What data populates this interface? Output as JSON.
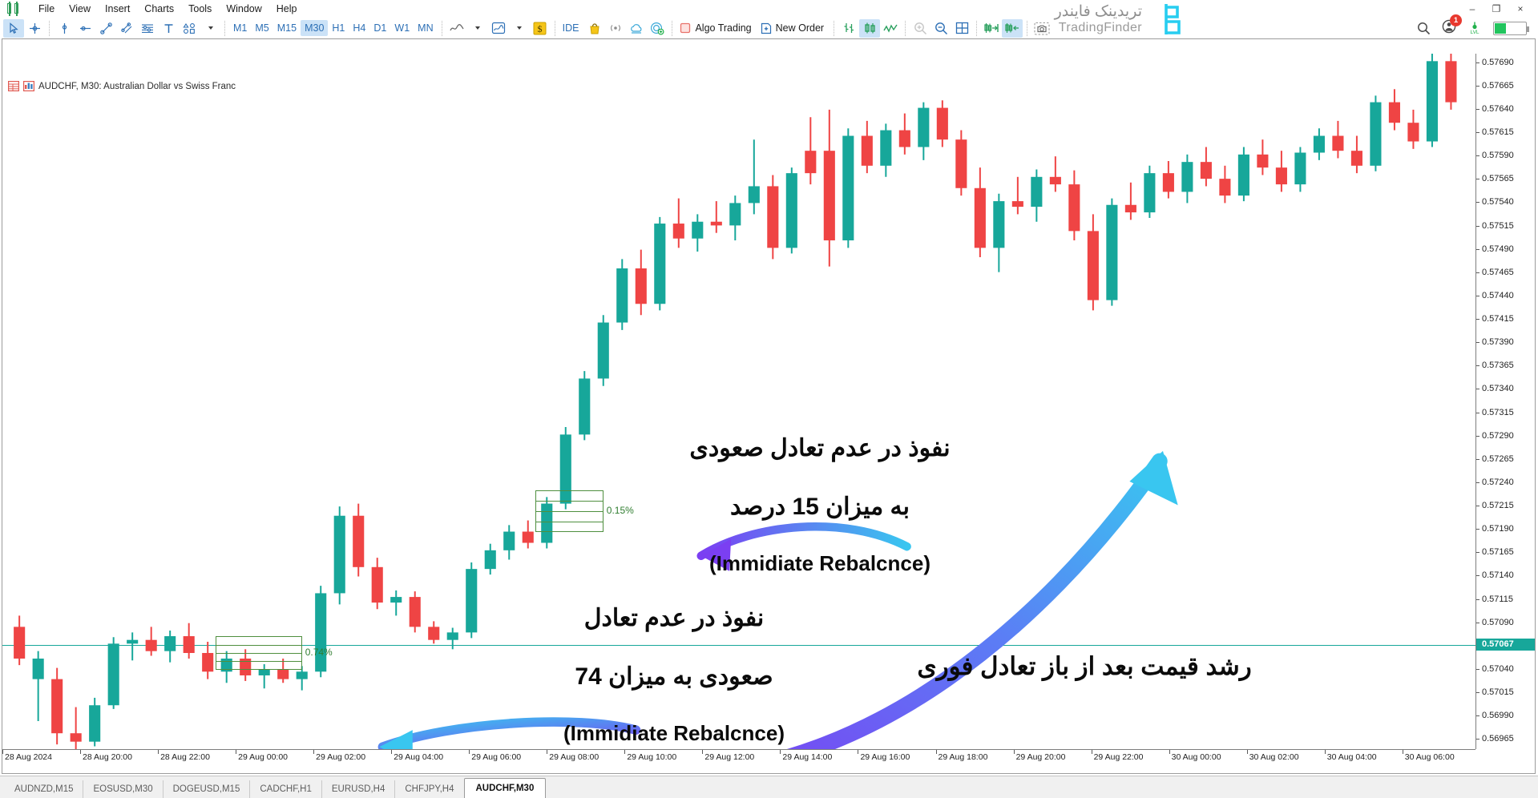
{
  "window": {
    "minimize": "–",
    "maximize": "❐",
    "close": "×"
  },
  "brand": {
    "fa": "تریدینک فایندر",
    "en": "TradingFinder",
    "mark_icon": "tradingfinder-logo-icon"
  },
  "topright": {
    "search_icon": "search-icon",
    "account_icon": "account-icon",
    "notification_count": "1",
    "level_icon": "level-meter-icon",
    "battery_icon": "battery-icon"
  },
  "menu": {
    "app_icon": "metatrader-logo-icon",
    "items": [
      {
        "label": "File"
      },
      {
        "label": "View"
      },
      {
        "label": "Insert"
      },
      {
        "label": "Charts"
      },
      {
        "label": "Tools"
      },
      {
        "label": "Window"
      },
      {
        "label": "Help"
      }
    ]
  },
  "toolbar": {
    "tools": [
      {
        "name": "cursor-tool",
        "icon": "arrow-cursor-icon",
        "active": true
      },
      {
        "name": "crosshair-tool",
        "icon": "crosshair-icon",
        "active": false
      },
      {
        "name": "vertical-line-tool",
        "icon": "vertical-line-icon",
        "active": false
      },
      {
        "name": "horizontal-line-tool",
        "icon": "horizontal-line-icon",
        "active": false
      },
      {
        "name": "trendline-tool",
        "icon": "trendline-icon",
        "active": false
      },
      {
        "name": "channel-tool",
        "icon": "equidistant-channel-icon",
        "active": false
      },
      {
        "name": "fibonacci-tool",
        "icon": "fibonacci-retracement-icon",
        "active": false
      },
      {
        "name": "text-tool",
        "icon": "text-label-icon",
        "active": false
      },
      {
        "name": "shapes-tool",
        "icon": "shapes-icon",
        "active": false
      }
    ],
    "timeframes": [
      {
        "label": "M1",
        "active": false
      },
      {
        "label": "M5",
        "active": false
      },
      {
        "label": "M15",
        "active": false
      },
      {
        "label": "M30",
        "active": true
      },
      {
        "label": "H1",
        "active": false
      },
      {
        "label": "H4",
        "active": false
      },
      {
        "label": "D1",
        "active": false
      },
      {
        "label": "W1",
        "active": false
      },
      {
        "label": "MN",
        "active": false
      }
    ],
    "indicators_icon": "indicator-line-icon",
    "templates_icon": "template-chart-icon",
    "autotrading_dollar_icon": "dollar-yellow-icon",
    "ide_label": "IDE",
    "market_icon": "market-bag-icon",
    "signals_icon": "signals-broadcast-icon",
    "vps_icon": "vps-cloud-icon",
    "copy_icon": "copy-trading-icon",
    "algo_trading_label": "Algo Trading",
    "algo_trading_icon": "algo-trading-stop-icon",
    "new_order_label": "New Order",
    "new_order_icon": "new-order-plus-icon",
    "bar_chart_icon": "bar-chart-icon",
    "candlestick_icon": "candlestick-chart-icon",
    "line_chart_icon": "line-chart-icon",
    "zoom_in_icon": "zoom-in-icon",
    "zoom_out_icon": "zoom-out-icon",
    "grid_icon": "grid-icon",
    "shift_end_icon": "chart-shift-icon",
    "autoscroll_icon": "auto-scroll-icon",
    "screenshot_icon": "screenshot-camera-icon"
  },
  "chart_header": {
    "data_window_icon": "data-window-icon",
    "properties_icon": "chart-properties-icon",
    "title": "AUDCHF, M30:  Australian Dollar vs Swiss Franc"
  },
  "annotations": [
    {
      "name": "annotation-upper-imbalance",
      "fa_line1": "نفوذ در عدم تعادل صعودی",
      "fa_line2": "به میزان 15 درصد",
      "en_line": "(Immidiate Rebalcnce)"
    },
    {
      "name": "annotation-lower-imbalance",
      "fa_line1": "نفوذ در عدم تعادل",
      "fa_line2": "صعودی به میزان 74",
      "en_line": "(Immidiate Rebalcnce)"
    },
    {
      "name": "annotation-price-growth",
      "fa_line1": "رشد قیمت بعد از باز تعادل فوری",
      "fa_line2": "",
      "en_line": ""
    }
  ],
  "fvg_boxes": [
    {
      "name": "fvg-box-upper",
      "label": "0.15%"
    },
    {
      "name": "fvg-box-lower",
      "label": "0.74%"
    }
  ],
  "tabs": [
    {
      "label": "AUDNZD,M15",
      "active": false
    },
    {
      "label": "EOSUSD,M30",
      "active": false
    },
    {
      "label": "DOGEUSD,M15",
      "active": false
    },
    {
      "label": "CADCHF,H1",
      "active": false
    },
    {
      "label": "EURUSD,H4",
      "active": false
    },
    {
      "label": "CHFJPY,H4",
      "active": false
    },
    {
      "label": "AUDCHF,M30",
      "active": true
    }
  ],
  "chart_data": {
    "type": "candlestick",
    "title": "AUDCHF, M30: Australian Dollar vs Swiss Franc",
    "symbol": "AUDCHF",
    "timeframe": "M30",
    "xlabel": "",
    "ylabel": "",
    "grid": false,
    "bull_color": "#17a79a",
    "bear_color": "#ef4444",
    "current_price": "0.57067",
    "ylim": [
      0.56955,
      0.577
    ],
    "y_ticks": [
      "0.57690",
      "0.57665",
      "0.57640",
      "0.57615",
      "0.57590",
      "0.57565",
      "0.57540",
      "0.57515",
      "0.57490",
      "0.57465",
      "0.57440",
      "0.57415",
      "0.57390",
      "0.57365",
      "0.57340",
      "0.57315",
      "0.57290",
      "0.57265",
      "0.57240",
      "0.57215",
      "0.57190",
      "0.57165",
      "0.57140",
      "0.57115",
      "0.57090",
      "0.57067",
      "0.57040",
      "0.57015",
      "0.56990",
      "0.56965"
    ],
    "x_ticks": [
      "28 Aug 2024",
      "28 Aug 20:00",
      "28 Aug 22:00",
      "29 Aug 00:00",
      "29 Aug 02:00",
      "29 Aug 04:00",
      "29 Aug 06:00",
      "29 Aug 08:00",
      "29 Aug 10:00",
      "29 Aug 12:00",
      "29 Aug 14:00",
      "29 Aug 16:00",
      "29 Aug 18:00",
      "29 Aug 20:00",
      "29 Aug 22:00",
      "30 Aug 00:00",
      "30 Aug 02:00",
      "30 Aug 04:00",
      "30 Aug 06:00"
    ],
    "candles": [
      {
        "o": 0.57086,
        "h": 0.57098,
        "l": 0.57045,
        "c": 0.57052,
        "d": "bear"
      },
      {
        "o": 0.57052,
        "h": 0.5706,
        "l": 0.56985,
        "c": 0.5703,
        "d": "bull"
      },
      {
        "o": 0.5703,
        "h": 0.57042,
        "l": 0.5696,
        "c": 0.56972,
        "d": "bear"
      },
      {
        "o": 0.56972,
        "h": 0.57,
        "l": 0.56955,
        "c": 0.56963,
        "d": "bear"
      },
      {
        "o": 0.56963,
        "h": 0.5701,
        "l": 0.56958,
        "c": 0.57002,
        "d": "bull"
      },
      {
        "o": 0.57002,
        "h": 0.57075,
        "l": 0.56998,
        "c": 0.57068,
        "d": "bull"
      },
      {
        "o": 0.57068,
        "h": 0.5708,
        "l": 0.5705,
        "c": 0.57072,
        "d": "bull"
      },
      {
        "o": 0.57072,
        "h": 0.57086,
        "l": 0.57055,
        "c": 0.5706,
        "d": "bear"
      },
      {
        "o": 0.5706,
        "h": 0.57082,
        "l": 0.57048,
        "c": 0.57076,
        "d": "bull"
      },
      {
        "o": 0.57076,
        "h": 0.5709,
        "l": 0.57052,
        "c": 0.57058,
        "d": "bear"
      },
      {
        "o": 0.57058,
        "h": 0.5707,
        "l": 0.5703,
        "c": 0.57038,
        "d": "bear"
      },
      {
        "o": 0.57038,
        "h": 0.5706,
        "l": 0.57026,
        "c": 0.57052,
        "d": "bull"
      },
      {
        "o": 0.57052,
        "h": 0.57062,
        "l": 0.57028,
        "c": 0.57034,
        "d": "bear"
      },
      {
        "o": 0.57034,
        "h": 0.57046,
        "l": 0.5702,
        "c": 0.5704,
        "d": "bull"
      },
      {
        "o": 0.5704,
        "h": 0.57052,
        "l": 0.57026,
        "c": 0.5703,
        "d": "bear"
      },
      {
        "o": 0.5703,
        "h": 0.57044,
        "l": 0.57018,
        "c": 0.57038,
        "d": "bull"
      },
      {
        "o": 0.57038,
        "h": 0.5713,
        "l": 0.57032,
        "c": 0.57122,
        "d": "bull"
      },
      {
        "o": 0.57122,
        "h": 0.57215,
        "l": 0.5711,
        "c": 0.57205,
        "d": "bull"
      },
      {
        "o": 0.57205,
        "h": 0.57218,
        "l": 0.5714,
        "c": 0.5715,
        "d": "bear"
      },
      {
        "o": 0.5715,
        "h": 0.5716,
        "l": 0.57105,
        "c": 0.57112,
        "d": "bear"
      },
      {
        "o": 0.57112,
        "h": 0.57125,
        "l": 0.57098,
        "c": 0.57118,
        "d": "bull"
      },
      {
        "o": 0.57118,
        "h": 0.57124,
        "l": 0.5708,
        "c": 0.57086,
        "d": "bear"
      },
      {
        "o": 0.57086,
        "h": 0.57092,
        "l": 0.57068,
        "c": 0.57072,
        "d": "bear"
      },
      {
        "o": 0.57072,
        "h": 0.57085,
        "l": 0.57062,
        "c": 0.5708,
        "d": "bull"
      },
      {
        "o": 0.5708,
        "h": 0.57155,
        "l": 0.57074,
        "c": 0.57148,
        "d": "bull"
      },
      {
        "o": 0.57148,
        "h": 0.57175,
        "l": 0.57142,
        "c": 0.57168,
        "d": "bull"
      },
      {
        "o": 0.57168,
        "h": 0.57195,
        "l": 0.57158,
        "c": 0.57188,
        "d": "bull"
      },
      {
        "o": 0.57188,
        "h": 0.572,
        "l": 0.5717,
        "c": 0.57176,
        "d": "bear"
      },
      {
        "o": 0.57176,
        "h": 0.57225,
        "l": 0.5717,
        "c": 0.57218,
        "d": "bull"
      },
      {
        "o": 0.57218,
        "h": 0.573,
        "l": 0.57212,
        "c": 0.57292,
        "d": "bull"
      },
      {
        "o": 0.57292,
        "h": 0.5736,
        "l": 0.57286,
        "c": 0.57352,
        "d": "bull"
      },
      {
        "o": 0.57352,
        "h": 0.5742,
        "l": 0.57344,
        "c": 0.57412,
        "d": "bull"
      },
      {
        "o": 0.57412,
        "h": 0.5748,
        "l": 0.57404,
        "c": 0.5747,
        "d": "bull"
      },
      {
        "o": 0.5747,
        "h": 0.5749,
        "l": 0.5742,
        "c": 0.57432,
        "d": "bear"
      },
      {
        "o": 0.57432,
        "h": 0.57525,
        "l": 0.57425,
        "c": 0.57518,
        "d": "bull"
      },
      {
        "o": 0.57518,
        "h": 0.57545,
        "l": 0.57492,
        "c": 0.57502,
        "d": "bear"
      },
      {
        "o": 0.57502,
        "h": 0.57528,
        "l": 0.57488,
        "c": 0.5752,
        "d": "bull"
      },
      {
        "o": 0.5752,
        "h": 0.57542,
        "l": 0.57508,
        "c": 0.57516,
        "d": "bear"
      },
      {
        "o": 0.57516,
        "h": 0.57548,
        "l": 0.575,
        "c": 0.5754,
        "d": "bull"
      },
      {
        "o": 0.5754,
        "h": 0.57608,
        "l": 0.57528,
        "c": 0.57558,
        "d": "bull"
      },
      {
        "o": 0.57558,
        "h": 0.5757,
        "l": 0.5748,
        "c": 0.57492,
        "d": "bear"
      },
      {
        "o": 0.57492,
        "h": 0.57578,
        "l": 0.57486,
        "c": 0.57572,
        "d": "bull"
      },
      {
        "o": 0.57572,
        "h": 0.57632,
        "l": 0.5756,
        "c": 0.57596,
        "d": "bear"
      },
      {
        "o": 0.57596,
        "h": 0.5764,
        "l": 0.57472,
        "c": 0.575,
        "d": "bear"
      },
      {
        "o": 0.575,
        "h": 0.5762,
        "l": 0.57492,
        "c": 0.57612,
        "d": "bull"
      },
      {
        "o": 0.57612,
        "h": 0.57628,
        "l": 0.57572,
        "c": 0.5758,
        "d": "bear"
      },
      {
        "o": 0.5758,
        "h": 0.57625,
        "l": 0.57568,
        "c": 0.57618,
        "d": "bull"
      },
      {
        "o": 0.57618,
        "h": 0.57636,
        "l": 0.57592,
        "c": 0.576,
        "d": "bear"
      },
      {
        "o": 0.576,
        "h": 0.57648,
        "l": 0.57586,
        "c": 0.57642,
        "d": "bull"
      },
      {
        "o": 0.57642,
        "h": 0.5765,
        "l": 0.576,
        "c": 0.57608,
        "d": "bear"
      },
      {
        "o": 0.57608,
        "h": 0.57618,
        "l": 0.57548,
        "c": 0.57556,
        "d": "bear"
      },
      {
        "o": 0.57556,
        "h": 0.57578,
        "l": 0.57482,
        "c": 0.57492,
        "d": "bear"
      },
      {
        "o": 0.57492,
        "h": 0.5755,
        "l": 0.57466,
        "c": 0.57542,
        "d": "bull"
      },
      {
        "o": 0.57542,
        "h": 0.57568,
        "l": 0.57528,
        "c": 0.57536,
        "d": "bear"
      },
      {
        "o": 0.57536,
        "h": 0.57576,
        "l": 0.5752,
        "c": 0.57568,
        "d": "bull"
      },
      {
        "o": 0.57568,
        "h": 0.5759,
        "l": 0.57552,
        "c": 0.5756,
        "d": "bear"
      },
      {
        "o": 0.5756,
        "h": 0.57575,
        "l": 0.575,
        "c": 0.5751,
        "d": "bear"
      },
      {
        "o": 0.5751,
        "h": 0.57528,
        "l": 0.57425,
        "c": 0.57436,
        "d": "bear"
      },
      {
        "o": 0.57436,
        "h": 0.57545,
        "l": 0.5743,
        "c": 0.57538,
        "d": "bull"
      },
      {
        "o": 0.57538,
        "h": 0.57562,
        "l": 0.57522,
        "c": 0.5753,
        "d": "bear"
      },
      {
        "o": 0.5753,
        "h": 0.5758,
        "l": 0.57524,
        "c": 0.57572,
        "d": "bull"
      },
      {
        "o": 0.57572,
        "h": 0.57585,
        "l": 0.57545,
        "c": 0.57552,
        "d": "bear"
      },
      {
        "o": 0.57552,
        "h": 0.57592,
        "l": 0.5754,
        "c": 0.57584,
        "d": "bull"
      },
      {
        "o": 0.57584,
        "h": 0.576,
        "l": 0.57558,
        "c": 0.57566,
        "d": "bear"
      },
      {
        "o": 0.57566,
        "h": 0.5758,
        "l": 0.5754,
        "c": 0.57548,
        "d": "bear"
      },
      {
        "o": 0.57548,
        "h": 0.576,
        "l": 0.57542,
        "c": 0.57592,
        "d": "bull"
      },
      {
        "o": 0.57592,
        "h": 0.57608,
        "l": 0.5757,
        "c": 0.57578,
        "d": "bear"
      },
      {
        "o": 0.57578,
        "h": 0.57596,
        "l": 0.57552,
        "c": 0.5756,
        "d": "bear"
      },
      {
        "o": 0.5756,
        "h": 0.576,
        "l": 0.57552,
        "c": 0.57594,
        "d": "bull"
      },
      {
        "o": 0.57594,
        "h": 0.5762,
        "l": 0.57586,
        "c": 0.57612,
        "d": "bull"
      },
      {
        "o": 0.57612,
        "h": 0.57628,
        "l": 0.57588,
        "c": 0.57596,
        "d": "bear"
      },
      {
        "o": 0.57596,
        "h": 0.57612,
        "l": 0.57572,
        "c": 0.5758,
        "d": "bear"
      },
      {
        "o": 0.5758,
        "h": 0.57655,
        "l": 0.57574,
        "c": 0.57648,
        "d": "bull"
      },
      {
        "o": 0.57648,
        "h": 0.57662,
        "l": 0.57618,
        "c": 0.57626,
        "d": "bear"
      },
      {
        "o": 0.57626,
        "h": 0.5764,
        "l": 0.57598,
        "c": 0.57606,
        "d": "bear"
      },
      {
        "o": 0.57606,
        "h": 0.577,
        "l": 0.576,
        "c": 0.57692,
        "d": "bull"
      },
      {
        "o": 0.57692,
        "h": 0.577,
        "l": 0.5764,
        "c": 0.57648,
        "d": "bear"
      }
    ]
  }
}
